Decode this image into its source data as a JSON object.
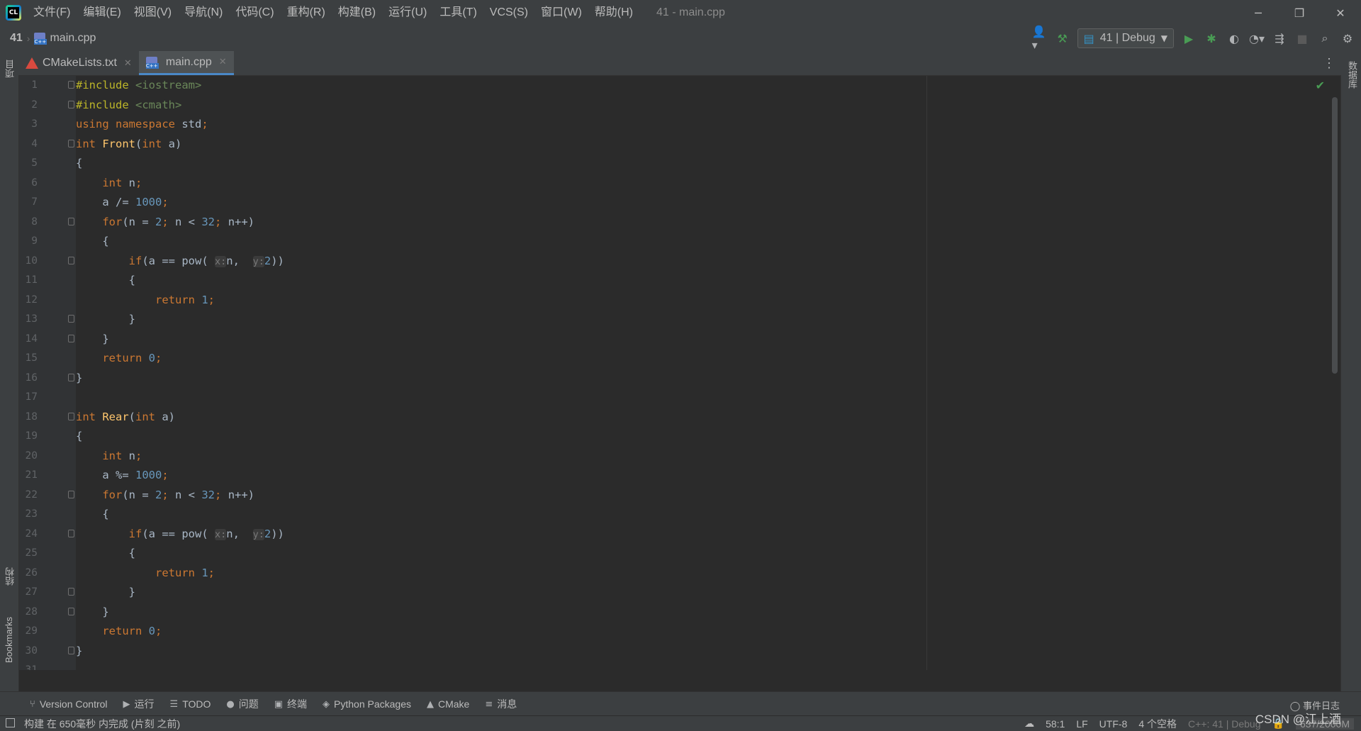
{
  "menu": [
    "文件(F)",
    "编辑(E)",
    "视图(V)",
    "导航(N)",
    "代码(C)",
    "重构(R)",
    "构建(B)",
    "运行(U)",
    "工具(T)",
    "VCS(S)",
    "窗口(W)",
    "帮助(H)"
  ],
  "window_title": "41 - main.cpp",
  "breadcrumb": {
    "project": "41",
    "file": "main.cpp"
  },
  "run_config": "41 | Debug",
  "tabs": [
    {
      "label": "CMakeLists.txt",
      "active": false
    },
    {
      "label": "main.cpp",
      "active": true
    }
  ],
  "left_panels": {
    "project": "项目",
    "structure": "结构",
    "bookmarks": "Bookmarks"
  },
  "right_panels": {
    "database": "数据库"
  },
  "editor": {
    "lines": [
      {
        "n": "1",
        "fold": true,
        "segs": [
          [
            "pp",
            "#include "
          ],
          [
            "str",
            "<iostream>"
          ]
        ]
      },
      {
        "n": "2",
        "fold": true,
        "segs": [
          [
            "pp",
            "#include "
          ],
          [
            "str",
            "<cmath>"
          ]
        ]
      },
      {
        "n": "3",
        "fold": false,
        "segs": [
          [
            "kw",
            "using namespace "
          ],
          [
            "",
            "std"
          ],
          [
            "kw",
            ";"
          ]
        ]
      },
      {
        "n": "4",
        "fold": true,
        "segs": [
          [
            "kw",
            "int "
          ],
          [
            "fn",
            "Front"
          ],
          [
            "",
            "("
          ],
          [
            "kw",
            "int "
          ],
          [
            "",
            "a)"
          ]
        ]
      },
      {
        "n": "5",
        "fold": false,
        "segs": [
          [
            "",
            "{"
          ]
        ]
      },
      {
        "n": "6",
        "fold": false,
        "segs": [
          [
            "",
            "    "
          ],
          [
            "kw",
            "int "
          ],
          [
            "",
            "n"
          ],
          [
            "kw",
            ";"
          ]
        ]
      },
      {
        "n": "7",
        "fold": false,
        "segs": [
          [
            "",
            "    a /= "
          ],
          [
            "num",
            "1000"
          ],
          [
            "kw",
            ";"
          ]
        ]
      },
      {
        "n": "8",
        "fold": true,
        "segs": [
          [
            "",
            "    "
          ],
          [
            "kw",
            "for"
          ],
          [
            "",
            "(n = "
          ],
          [
            "num",
            "2"
          ],
          [
            "kw",
            "; "
          ],
          [
            "",
            "n < "
          ],
          [
            "num",
            "32"
          ],
          [
            "kw",
            "; "
          ],
          [
            "",
            "n++)"
          ]
        ]
      },
      {
        "n": "9",
        "fold": false,
        "segs": [
          [
            "",
            "    {"
          ]
        ]
      },
      {
        "n": "10",
        "fold": true,
        "segs": [
          [
            "",
            "        "
          ],
          [
            "kw",
            "if"
          ],
          [
            "",
            "(a == pow( "
          ],
          [
            "hint",
            "x:"
          ],
          [
            "",
            "n,  "
          ],
          [
            "hint",
            "y:"
          ],
          [
            "num",
            "2"
          ],
          [
            "",
            "))"
          ]
        ]
      },
      {
        "n": "11",
        "fold": false,
        "segs": [
          [
            "",
            "        {"
          ]
        ]
      },
      {
        "n": "12",
        "fold": false,
        "segs": [
          [
            "",
            "            "
          ],
          [
            "kw",
            "return "
          ],
          [
            "num",
            "1"
          ],
          [
            "kw",
            ";"
          ]
        ]
      },
      {
        "n": "13",
        "fold": true,
        "segs": [
          [
            "",
            "        }"
          ]
        ]
      },
      {
        "n": "14",
        "fold": true,
        "segs": [
          [
            "",
            "    }"
          ]
        ]
      },
      {
        "n": "15",
        "fold": false,
        "segs": [
          [
            "",
            "    "
          ],
          [
            "kw",
            "return "
          ],
          [
            "num",
            "0"
          ],
          [
            "kw",
            ";"
          ]
        ]
      },
      {
        "n": "16",
        "fold": true,
        "segs": [
          [
            "",
            "}"
          ]
        ]
      },
      {
        "n": "17",
        "fold": false,
        "segs": []
      },
      {
        "n": "18",
        "fold": true,
        "segs": [
          [
            "kw",
            "int "
          ],
          [
            "fn",
            "Rear"
          ],
          [
            "",
            "("
          ],
          [
            "kw",
            "int "
          ],
          [
            "",
            "a)"
          ]
        ]
      },
      {
        "n": "19",
        "fold": false,
        "segs": [
          [
            "",
            "{"
          ]
        ]
      },
      {
        "n": "20",
        "fold": false,
        "segs": [
          [
            "",
            "    "
          ],
          [
            "kw",
            "int "
          ],
          [
            "",
            "n"
          ],
          [
            "kw",
            ";"
          ]
        ]
      },
      {
        "n": "21",
        "fold": false,
        "segs": [
          [
            "",
            "    a %= "
          ],
          [
            "num",
            "1000"
          ],
          [
            "kw",
            ";"
          ]
        ]
      },
      {
        "n": "22",
        "fold": true,
        "segs": [
          [
            "",
            "    "
          ],
          [
            "kw",
            "for"
          ],
          [
            "",
            "(n = "
          ],
          [
            "num",
            "2"
          ],
          [
            "kw",
            "; "
          ],
          [
            "",
            "n < "
          ],
          [
            "num",
            "32"
          ],
          [
            "kw",
            "; "
          ],
          [
            "",
            "n++)"
          ]
        ]
      },
      {
        "n": "23",
        "fold": false,
        "segs": [
          [
            "",
            "    {"
          ]
        ]
      },
      {
        "n": "24",
        "fold": true,
        "segs": [
          [
            "",
            "        "
          ],
          [
            "kw",
            "if"
          ],
          [
            "",
            "(a == pow( "
          ],
          [
            "hint",
            "x:"
          ],
          [
            "",
            "n,  "
          ],
          [
            "hint",
            "y:"
          ],
          [
            "num",
            "2"
          ],
          [
            "",
            "))"
          ]
        ]
      },
      {
        "n": "25",
        "fold": false,
        "segs": [
          [
            "",
            "        {"
          ]
        ]
      },
      {
        "n": "26",
        "fold": false,
        "segs": [
          [
            "",
            "            "
          ],
          [
            "kw",
            "return "
          ],
          [
            "num",
            "1"
          ],
          [
            "kw",
            ";"
          ]
        ]
      },
      {
        "n": "27",
        "fold": true,
        "segs": [
          [
            "",
            "        }"
          ]
        ]
      },
      {
        "n": "28",
        "fold": true,
        "segs": [
          [
            "",
            "    }"
          ]
        ]
      },
      {
        "n": "29",
        "fold": false,
        "segs": [
          [
            "",
            "    "
          ],
          [
            "kw",
            "return "
          ],
          [
            "num",
            "0"
          ],
          [
            "kw",
            ";"
          ]
        ]
      },
      {
        "n": "30",
        "fold": true,
        "segs": [
          [
            "",
            "}"
          ]
        ]
      },
      {
        "n": "31",
        "fold": false,
        "segs": []
      }
    ]
  },
  "bottom_tools": [
    {
      "icon": "version-control-icon",
      "glyph": "⑂",
      "label": "Version Control"
    },
    {
      "icon": "run-icon",
      "glyph": "▶",
      "label": "运行"
    },
    {
      "icon": "todo-icon",
      "glyph": "☰",
      "label": "TODO"
    },
    {
      "icon": "problems-icon",
      "glyph": "●",
      "label": "问题"
    },
    {
      "icon": "terminal-icon",
      "glyph": "▣",
      "label": "终端"
    },
    {
      "icon": "python-packages-icon",
      "glyph": "◈",
      "label": "Python Packages"
    },
    {
      "icon": "cmake-icon",
      "glyph": "▲",
      "label": "CMake"
    },
    {
      "icon": "messages-icon",
      "glyph": "≡",
      "label": "消息"
    }
  ],
  "event_log": "事件日志",
  "status": {
    "message": "构建 在 650毫秒 内完成 (片刻 之前)",
    "position": "58:1",
    "line_sep": "LF",
    "encoding": "UTF-8",
    "indent": "4 个空格",
    "context": "C++: 41 | Debug",
    "memory": "637/2000M"
  },
  "watermark": "CSDN @江上酒"
}
